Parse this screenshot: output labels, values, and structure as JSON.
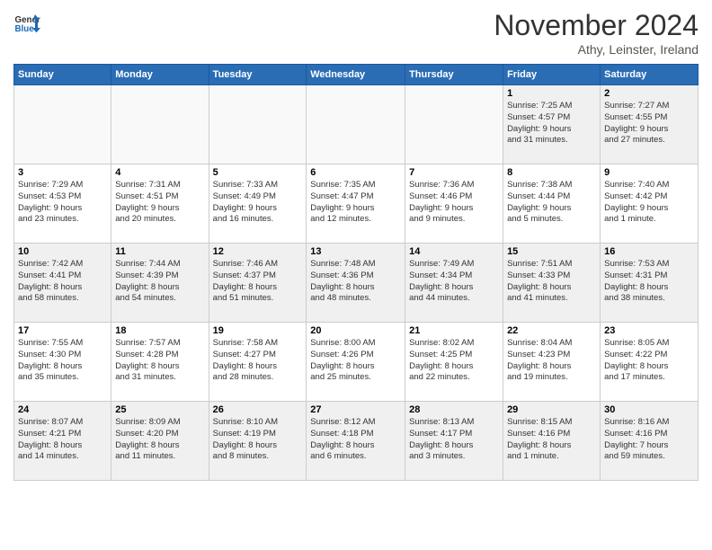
{
  "header": {
    "logo_line1": "General",
    "logo_line2": "Blue",
    "month": "November 2024",
    "location": "Athy, Leinster, Ireland"
  },
  "weekdays": [
    "Sunday",
    "Monday",
    "Tuesday",
    "Wednesday",
    "Thursday",
    "Friday",
    "Saturday"
  ],
  "weeks": [
    [
      {
        "day": "",
        "info": ""
      },
      {
        "day": "",
        "info": ""
      },
      {
        "day": "",
        "info": ""
      },
      {
        "day": "",
        "info": ""
      },
      {
        "day": "",
        "info": ""
      },
      {
        "day": "1",
        "info": "Sunrise: 7:25 AM\nSunset: 4:57 PM\nDaylight: 9 hours\nand 31 minutes."
      },
      {
        "day": "2",
        "info": "Sunrise: 7:27 AM\nSunset: 4:55 PM\nDaylight: 9 hours\nand 27 minutes."
      }
    ],
    [
      {
        "day": "3",
        "info": "Sunrise: 7:29 AM\nSunset: 4:53 PM\nDaylight: 9 hours\nand 23 minutes."
      },
      {
        "day": "4",
        "info": "Sunrise: 7:31 AM\nSunset: 4:51 PM\nDaylight: 9 hours\nand 20 minutes."
      },
      {
        "day": "5",
        "info": "Sunrise: 7:33 AM\nSunset: 4:49 PM\nDaylight: 9 hours\nand 16 minutes."
      },
      {
        "day": "6",
        "info": "Sunrise: 7:35 AM\nSunset: 4:47 PM\nDaylight: 9 hours\nand 12 minutes."
      },
      {
        "day": "7",
        "info": "Sunrise: 7:36 AM\nSunset: 4:46 PM\nDaylight: 9 hours\nand 9 minutes."
      },
      {
        "day": "8",
        "info": "Sunrise: 7:38 AM\nSunset: 4:44 PM\nDaylight: 9 hours\nand 5 minutes."
      },
      {
        "day": "9",
        "info": "Sunrise: 7:40 AM\nSunset: 4:42 PM\nDaylight: 9 hours\nand 1 minute."
      }
    ],
    [
      {
        "day": "10",
        "info": "Sunrise: 7:42 AM\nSunset: 4:41 PM\nDaylight: 8 hours\nand 58 minutes."
      },
      {
        "day": "11",
        "info": "Sunrise: 7:44 AM\nSunset: 4:39 PM\nDaylight: 8 hours\nand 54 minutes."
      },
      {
        "day": "12",
        "info": "Sunrise: 7:46 AM\nSunset: 4:37 PM\nDaylight: 8 hours\nand 51 minutes."
      },
      {
        "day": "13",
        "info": "Sunrise: 7:48 AM\nSunset: 4:36 PM\nDaylight: 8 hours\nand 48 minutes."
      },
      {
        "day": "14",
        "info": "Sunrise: 7:49 AM\nSunset: 4:34 PM\nDaylight: 8 hours\nand 44 minutes."
      },
      {
        "day": "15",
        "info": "Sunrise: 7:51 AM\nSunset: 4:33 PM\nDaylight: 8 hours\nand 41 minutes."
      },
      {
        "day": "16",
        "info": "Sunrise: 7:53 AM\nSunset: 4:31 PM\nDaylight: 8 hours\nand 38 minutes."
      }
    ],
    [
      {
        "day": "17",
        "info": "Sunrise: 7:55 AM\nSunset: 4:30 PM\nDaylight: 8 hours\nand 35 minutes."
      },
      {
        "day": "18",
        "info": "Sunrise: 7:57 AM\nSunset: 4:28 PM\nDaylight: 8 hours\nand 31 minutes."
      },
      {
        "day": "19",
        "info": "Sunrise: 7:58 AM\nSunset: 4:27 PM\nDaylight: 8 hours\nand 28 minutes."
      },
      {
        "day": "20",
        "info": "Sunrise: 8:00 AM\nSunset: 4:26 PM\nDaylight: 8 hours\nand 25 minutes."
      },
      {
        "day": "21",
        "info": "Sunrise: 8:02 AM\nSunset: 4:25 PM\nDaylight: 8 hours\nand 22 minutes."
      },
      {
        "day": "22",
        "info": "Sunrise: 8:04 AM\nSunset: 4:23 PM\nDaylight: 8 hours\nand 19 minutes."
      },
      {
        "day": "23",
        "info": "Sunrise: 8:05 AM\nSunset: 4:22 PM\nDaylight: 8 hours\nand 17 minutes."
      }
    ],
    [
      {
        "day": "24",
        "info": "Sunrise: 8:07 AM\nSunset: 4:21 PM\nDaylight: 8 hours\nand 14 minutes."
      },
      {
        "day": "25",
        "info": "Sunrise: 8:09 AM\nSunset: 4:20 PM\nDaylight: 8 hours\nand 11 minutes."
      },
      {
        "day": "26",
        "info": "Sunrise: 8:10 AM\nSunset: 4:19 PM\nDaylight: 8 hours\nand 8 minutes."
      },
      {
        "day": "27",
        "info": "Sunrise: 8:12 AM\nSunset: 4:18 PM\nDaylight: 8 hours\nand 6 minutes."
      },
      {
        "day": "28",
        "info": "Sunrise: 8:13 AM\nSunset: 4:17 PM\nDaylight: 8 hours\nand 3 minutes."
      },
      {
        "day": "29",
        "info": "Sunrise: 8:15 AM\nSunset: 4:16 PM\nDaylight: 8 hours\nand 1 minute."
      },
      {
        "day": "30",
        "info": "Sunrise: 8:16 AM\nSunset: 4:16 PM\nDaylight: 7 hours\nand 59 minutes."
      }
    ]
  ]
}
